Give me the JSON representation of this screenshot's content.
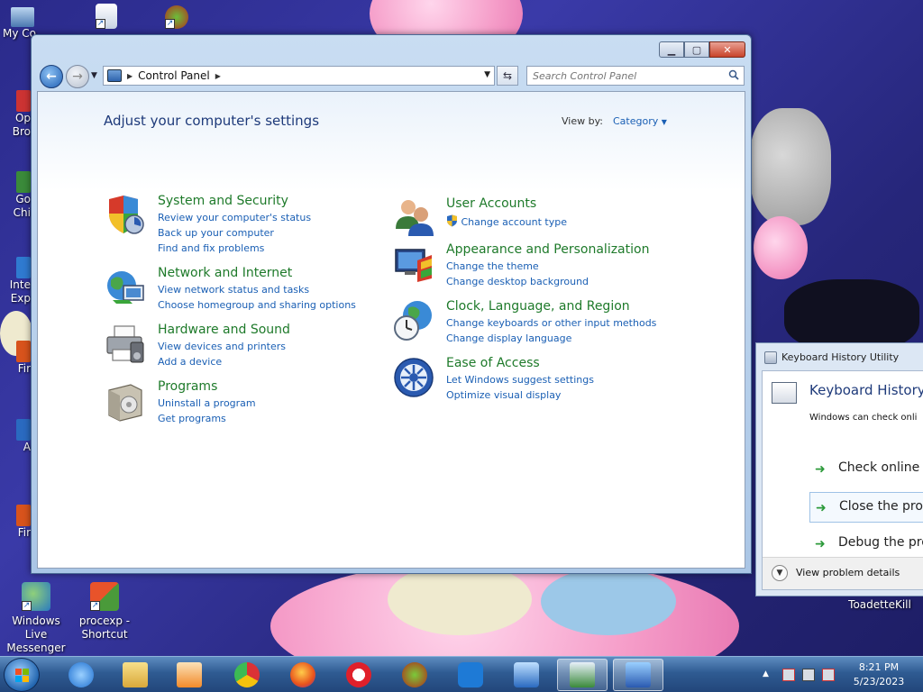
{
  "desktop": {
    "icons": [
      {
        "label": "My Co"
      },
      {
        "label": "Op Bro"
      },
      {
        "label": "Go Chi"
      },
      {
        "label": "Inte Exp"
      },
      {
        "label": "Fir"
      },
      {
        "label": "A"
      },
      {
        "label": "Fir"
      },
      {
        "label": "Windows Live Messenger"
      },
      {
        "label": "procexp - Shortcut"
      },
      {
        "label": "ToadetteKill"
      }
    ]
  },
  "control_panel": {
    "address": {
      "crumb": "Control Panel"
    },
    "search": {
      "placeholder": "Search Control Panel"
    },
    "page_title": "Adjust your computer's settings",
    "view_by": {
      "label": "View by:",
      "value": "Category"
    },
    "categories_left": [
      {
        "title": "System and Security",
        "links": [
          "Review your computer's status",
          "Back up your computer",
          "Find and fix problems"
        ]
      },
      {
        "title": "Network and Internet",
        "links": [
          "View network status and tasks",
          "Choose homegroup and sharing options"
        ]
      },
      {
        "title": "Hardware and Sound",
        "links": [
          "View devices and printers",
          "Add a device"
        ]
      },
      {
        "title": "Programs",
        "links": [
          "Uninstall a program",
          "Get programs"
        ]
      }
    ],
    "categories_right": [
      {
        "title": "User Accounts",
        "links": [
          "Change account type"
        ]
      },
      {
        "title": "Appearance and Personalization",
        "links": [
          "Change the theme",
          "Change desktop background"
        ]
      },
      {
        "title": "Clock, Language, and Region",
        "links": [
          "Change keyboards or other input methods",
          "Change display language"
        ]
      },
      {
        "title": "Ease of Access",
        "links": [
          "Let Windows suggest settings",
          "Optimize visual display"
        ]
      }
    ]
  },
  "keyboard_history": {
    "window_title": "Keyboard History Utility",
    "heading": "Keyboard History U",
    "description": "Windows can check onli",
    "options": [
      "Check online",
      "Close the prog",
      "Debug the pro"
    ],
    "details": "View problem details"
  },
  "taskbar": {
    "clock": {
      "time": "8:21 PM",
      "date": "5/23/2023"
    }
  },
  "colors": {
    "link": "#1a5fb4",
    "category_title": "#1e7a2a",
    "heading": "#1e3a7a",
    "taskbar": "#2f5b92"
  }
}
